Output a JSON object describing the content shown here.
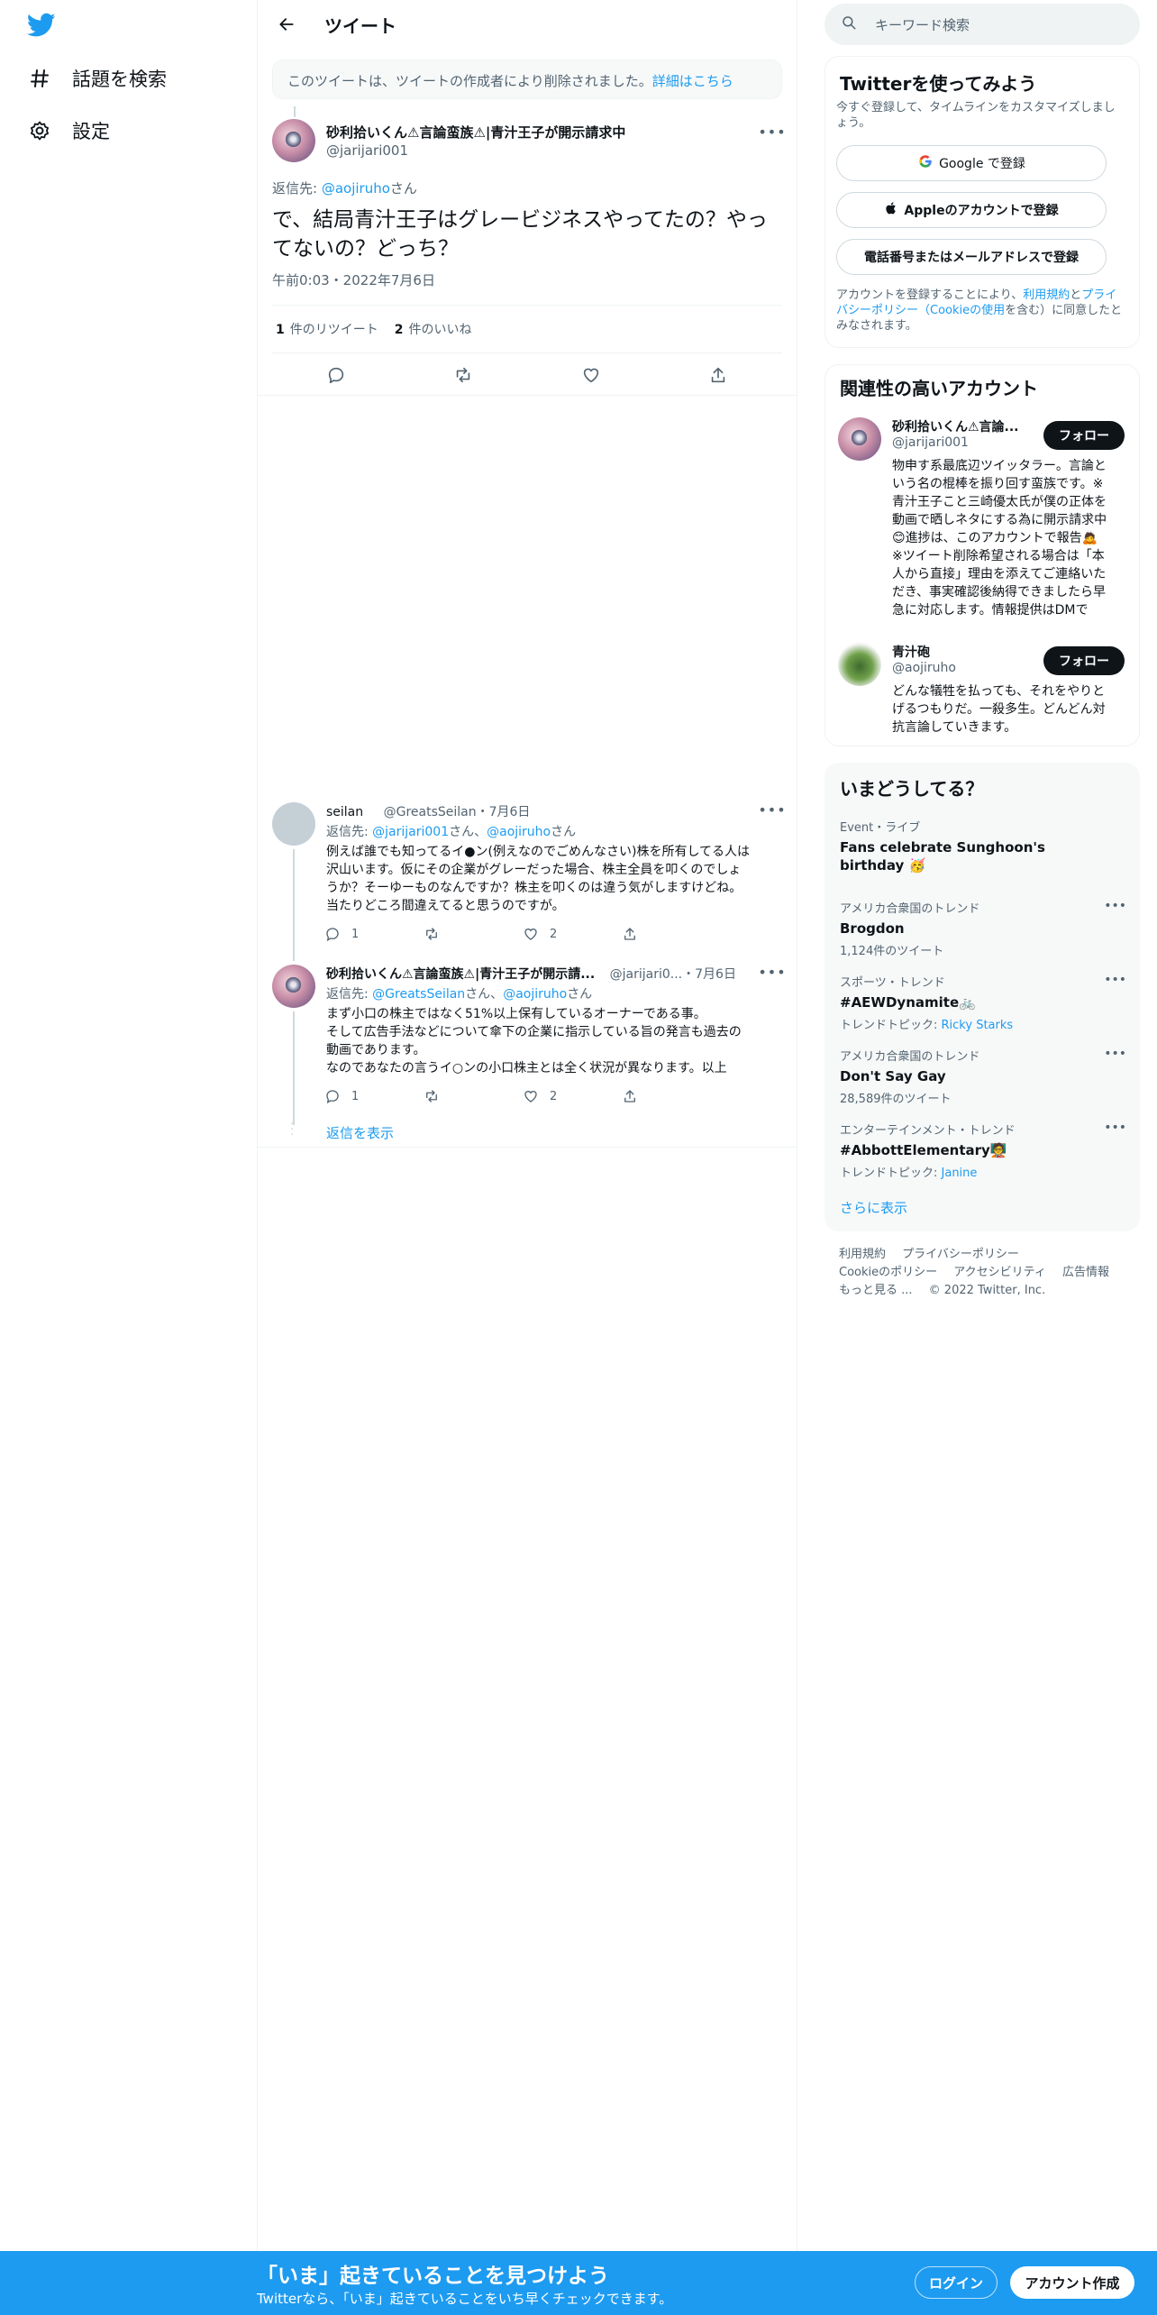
{
  "nav": {
    "explore": "話題を検索",
    "settings": "設定"
  },
  "header": {
    "title": "ツイート"
  },
  "deleted_notice": {
    "text": "このツイートは、ツイートの作成者により削除されました。",
    "link": "詳細はこちら"
  },
  "main_tweet": {
    "name": "砂利拾いくん⚠言論蛮族⚠|青汁王子が開示請求中",
    "handle": "@jarijari001",
    "reply_prefix": "返信先: ",
    "reply_to": "@aojiruho",
    "reply_suffix": "さん",
    "text": "で、結局青汁王子はグレービジネスやってたの？やってないの？どっち？",
    "date": "午前0:03・2022年7月6日",
    "retweets_count": "1",
    "retweets_label": "件のリツイート",
    "likes_count": "2",
    "likes_label": "件のいいね"
  },
  "replies": [
    {
      "name": "seilan",
      "handle": "@GreatsSeilan",
      "date": "・7月6日",
      "reply_prefix": "返信先: ",
      "reply_to_1": "@jarijari001",
      "reply_mid": "さん、",
      "reply_to_2": "@aojiruho",
      "reply_suffix": "さん",
      "lines": [
        "例えば誰でも知ってるイ●ン(例えなのでごめんなさい)株を所有してる人は",
        "沢山います。仮にその企業がグレーだった場合、株主全員を叩くのでしょ",
        "うか？そーゆーものなんですか？株主を叩くのは違う気がしますけどね。",
        "当たりどころ間違えてると思うのですが。"
      ],
      "replies_count": "1",
      "likes_count": "2"
    },
    {
      "name": "砂利拾いくん⚠言論蛮族⚠|青汁王子が開示請...",
      "handle": "@jarijari0...",
      "date": "・7月6日",
      "reply_prefix": "返信先: ",
      "reply_to_1": "@GreatsSeilan",
      "reply_mid": "さん、",
      "reply_to_2": "@aojiruho",
      "reply_suffix": "さん",
      "lines": [
        "まず小口の株主ではなく51%以上保有しているオーナーである事。",
        "そして広告手法などについて傘下の企業に指示している旨の発言も過去の",
        "動画であります。",
        "なのであなたの言うイ○ンの小口株主とは全く状況が異なります。以上"
      ],
      "replies_count": "1",
      "likes_count": "2",
      "show_replies": "返信を表示"
    }
  ],
  "right": {
    "search_placeholder": "キーワード検索",
    "signup_card": {
      "title": "Twitterを使ってみよう",
      "subtitle_1": "今すぐ登録して、タイムラインをカスタマイズしまし",
      "subtitle_2": "ょう。",
      "google": "Google で登録",
      "apple": "Appleのアカウントで登録",
      "phone_email": "電話番号またはメールアドレスで登録",
      "terms_1": "アカウントを登録することにより、",
      "terms_link1": "利用規約",
      "terms_2": "と",
      "terms_link2a": "プライ",
      "terms_link2b": "バシーポリシー（Cookieの使用",
      "terms_3": "を含む）に同意したと",
      "terms_4": "みなされます。"
    },
    "related": {
      "title": "関連性の高いアカウント",
      "follow": "フォロー",
      "accounts": [
        {
          "name": "砂利拾いくん⚠言論...",
          "handle": "@jarijari001",
          "bio": [
            "物申す系最底辺ツイッタラー。言論と",
            "いう名の棍棒を振り回す蛮族です。※",
            "青汁王子こと三崎優太氏が僕の正体を",
            "動画で晒しネタにする為に開示請求中",
            "😊進捗は、このアカウントで報告🙇",
            "※ツイート削除希望される場合は「本",
            "人から直接」理由を添えてご連絡いた",
            "だき、事実確認後納得できましたら早",
            "急に対応します。情報提供はDMで"
          ]
        },
        {
          "name": "青汁砲",
          "handle": "@aojiruho",
          "bio": [
            "どんな犠牲を払っても、それをやりと",
            "げるつもりだ。一殺多生。どんどん対",
            "抗言論していきます。"
          ]
        }
      ]
    },
    "trends": {
      "title": "いまどうしてる？",
      "items": [
        {
          "meta": "Event・ライブ",
          "name_1": "Fans celebrate Sunghoon's",
          "name_2": "birthday 🥳",
          "sub": ""
        },
        {
          "meta": "アメリカ合衆国のトレンド",
          "name_1": "Brogdon",
          "name_2": "",
          "sub": "1,124件のツイート"
        },
        {
          "meta": "スポーツ・トレンド",
          "name_1": "#AEWDynamite🚲",
          "name_2": "",
          "sub_prefix": "トレンドトピック: ",
          "sub_link": "Ricky Starks"
        },
        {
          "meta": "アメリカ合衆国のトレンド",
          "name_1": "Don't Say Gay",
          "name_2": "",
          "sub": "28,589件のツイート"
        },
        {
          "meta": "エンターテインメント・トレンド",
          "name_1": "#AbbottElementary🧑‍🏫",
          "name_2": "",
          "sub_prefix": "トレンドトピック: ",
          "sub_link": "Janine"
        }
      ],
      "show_more": "さらに表示"
    },
    "footer": {
      "links_1": [
        "利用規約",
        "プライバシーポリシー"
      ],
      "links_2": [
        "Cookieのポリシー",
        "アクセシビリティ",
        "広告情報"
      ],
      "more": "もっと見る ...",
      "copyright": "© 2022 Twitter, Inc."
    }
  },
  "bottom_bar": {
    "title": "「いま」起きていることを見つけよう",
    "subtitle": "Twitterなら、「いま」起きていることをいち早くチェックできます。",
    "login": "ログイン",
    "signup": "アカウント作成"
  },
  "colors": {
    "accent": "#1d9bf0",
    "text": "#0f1419",
    "secondary": "#536471"
  }
}
